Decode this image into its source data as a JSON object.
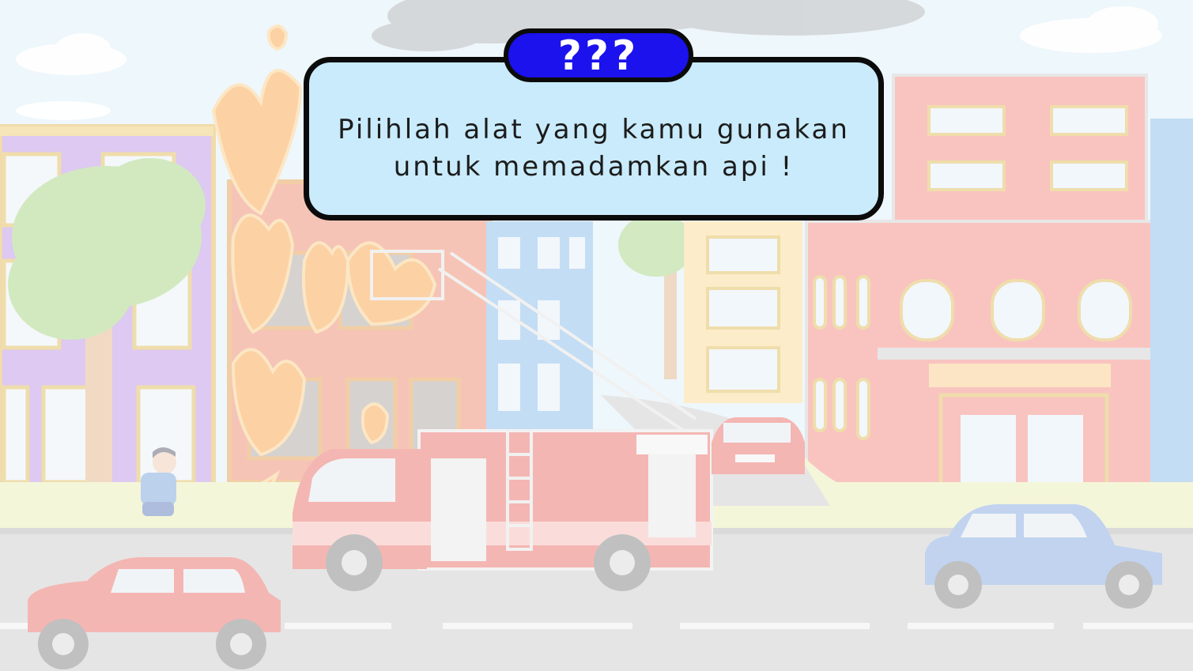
{
  "badge": {
    "label": "???"
  },
  "prompt": {
    "line1": "Pilihlah alat yang kamu gunakan",
    "line2": "untuk memadamkan api !"
  },
  "colors": {
    "sky": "#dff0f8",
    "panel_fill": "#c9ebfb",
    "panel_border": "#0b0b0b",
    "badge_fill": "#1b12ee",
    "badge_text": "#ffffff",
    "road": "#d6d6d6",
    "fire": "#f9a03f",
    "fire_truck": "#e44a44"
  },
  "scene": {
    "description_icons": [
      "cloud-icon",
      "smoke-icon",
      "fire-icon",
      "building-icon",
      "tree-icon",
      "fire-truck-icon",
      "ladder-icon",
      "car-icon",
      "person-icon"
    ]
  }
}
